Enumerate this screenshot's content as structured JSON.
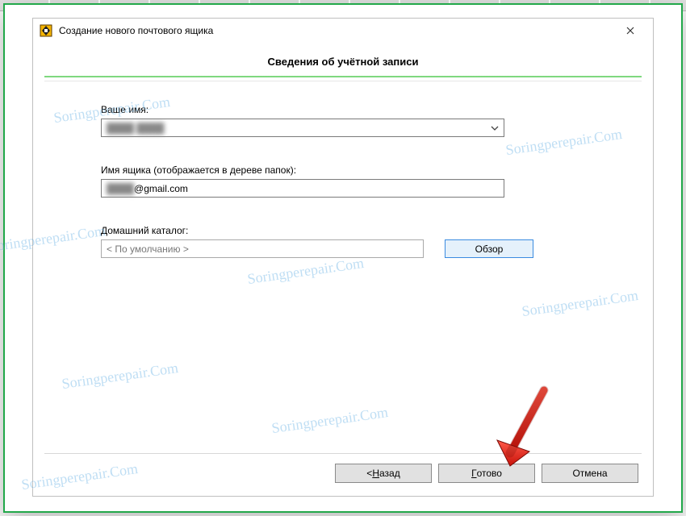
{
  "window": {
    "title": "Создание нового почтового ящика"
  },
  "heading": "Сведения об учётной записи",
  "fields": {
    "name_label": "Ваше имя:",
    "name_value": "████ ████",
    "mailbox_label": "Имя ящика (отображается в дереве папок):",
    "mailbox_prefix": "████",
    "mailbox_suffix": "@gmail.com",
    "home_label": "Домашний каталог:",
    "home_value": "< По умолчанию >",
    "browse_label": "Обзор"
  },
  "buttons": {
    "back_prefix": "<  ",
    "back_u": "Н",
    "back_rest": "азад",
    "finish_u": "Г",
    "finish_rest": "отово",
    "cancel": "Отмена"
  },
  "watermark": "Soringperepair.Com"
}
